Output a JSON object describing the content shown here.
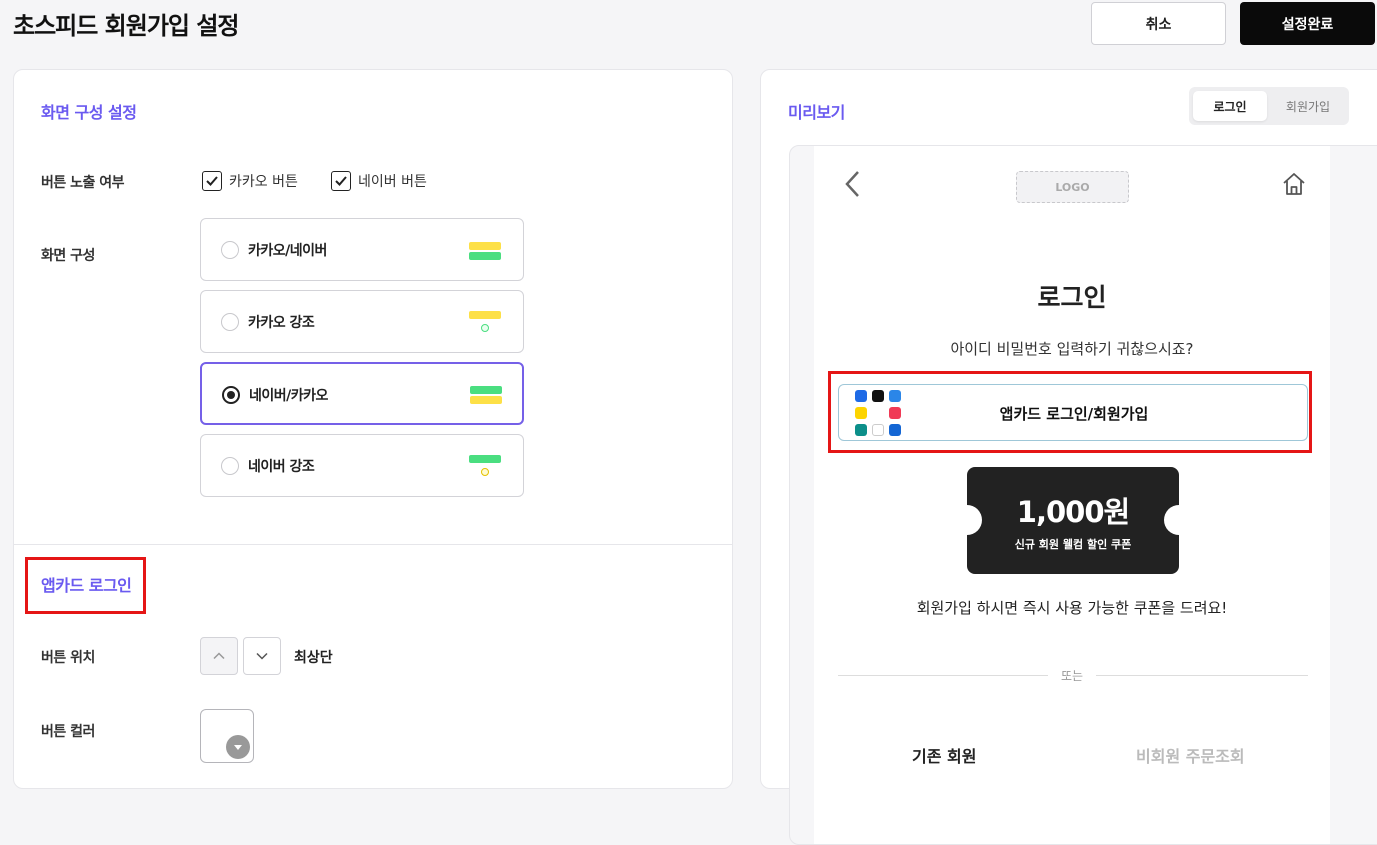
{
  "header": {
    "title": "초스피드 회원가입 설정",
    "cancel_label": "취소",
    "done_label": "설정완료"
  },
  "screen_config": {
    "section_title": "화면 구성 설정",
    "button_visibility_label": "버튼 노출 여부",
    "checkboxes": [
      {
        "label": "카카오 버튼",
        "checked": true
      },
      {
        "label": "네이버 버튼",
        "checked": true
      }
    ],
    "layout_label": "화면 구성",
    "layout_options": [
      {
        "label": "카카오/네이버",
        "selected": false
      },
      {
        "label": "카카오 강조",
        "selected": false
      },
      {
        "label": "네이버/카카오",
        "selected": true
      },
      {
        "label": "네이버 강조",
        "selected": false
      }
    ]
  },
  "appcard_login": {
    "section_title": "앱카드 로그인",
    "position_label": "버튼 위치",
    "position_value": "최상단",
    "color_label": "버튼 컬러"
  },
  "preview": {
    "title": "미리보기",
    "tabs": [
      {
        "label": "로그인",
        "active": true
      },
      {
        "label": "회원가입",
        "active": false
      }
    ],
    "logo_text": "LOGO",
    "login_title": "로그인",
    "login_subtitle": "아이디 비밀번호 입력하기 귀찮으시죠?",
    "appcard_button_label": "앱카드 로그인/회원가입",
    "coupon_amount": "1,000원",
    "coupon_desc": "신규 회원 웰컴 할인 쿠폰",
    "coupon_message": "회원가입 하시면 즉시 사용 가능한 쿠폰을 드려요!",
    "or_text": "또는",
    "member_tab": "기존 회원",
    "guest_tab": "비회원 주문조회"
  },
  "colors": {
    "accent": "#6a5af0",
    "highlight_red": "#e51616",
    "kakao_yellow": "#fde047",
    "naver_green": "#4ade80"
  }
}
